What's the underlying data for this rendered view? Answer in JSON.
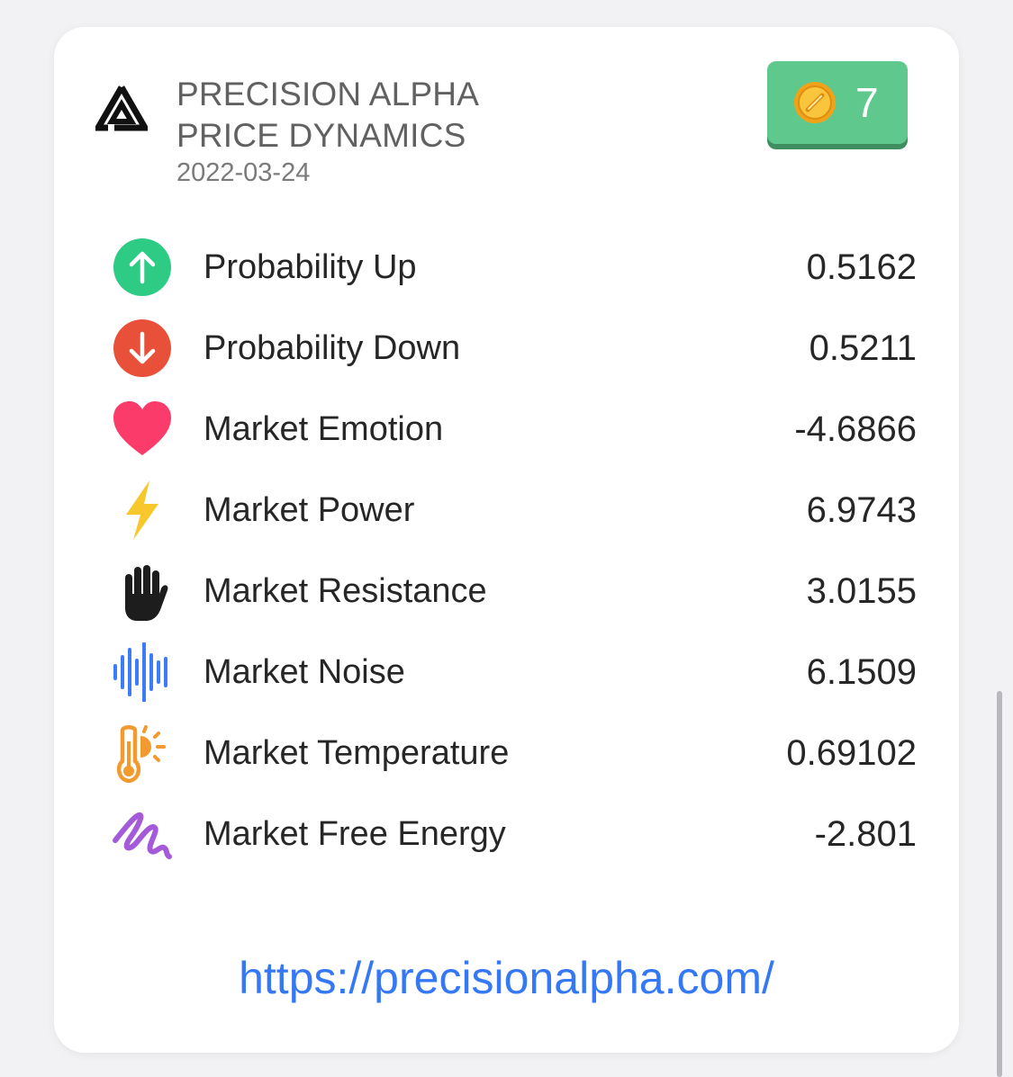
{
  "header": {
    "title_line1": "PRECISION ALPHA",
    "title_line2": "PRICE DYNAMICS",
    "date": "2022-03-24"
  },
  "badge": {
    "icon": "coin-icon",
    "count": "7",
    "color": "#5fc98d"
  },
  "metrics": [
    {
      "icon": "arrow-up-circle-icon",
      "label": "Probability Up",
      "value": "0.5162",
      "color": "#2ecb85"
    },
    {
      "icon": "arrow-down-circle-icon",
      "label": "Probability Down",
      "value": "0.5211",
      "color": "#e8503a"
    },
    {
      "icon": "heart-icon",
      "label": "Market Emotion",
      "value": "-4.6866",
      "color": "#fb3b6a"
    },
    {
      "icon": "lightning-icon",
      "label": "Market Power",
      "value": "6.9743",
      "color": "#f7c72b"
    },
    {
      "icon": "hand-icon",
      "label": "Market Resistance",
      "value": "3.0155",
      "color": "#1d1d1d"
    },
    {
      "icon": "waveform-icon",
      "label": "Market Noise",
      "value": "6.1509",
      "color": "#3b7df6"
    },
    {
      "icon": "thermometer-sun-icon",
      "label": "Market Temperature",
      "value": "0.69102",
      "color": "#f29a2e"
    },
    {
      "icon": "scribble-icon",
      "label": "Market Free Energy",
      "value": "-2.801",
      "color": "#a55bd9"
    }
  ],
  "footer": {
    "link": "https://precisionalpha.com/"
  }
}
